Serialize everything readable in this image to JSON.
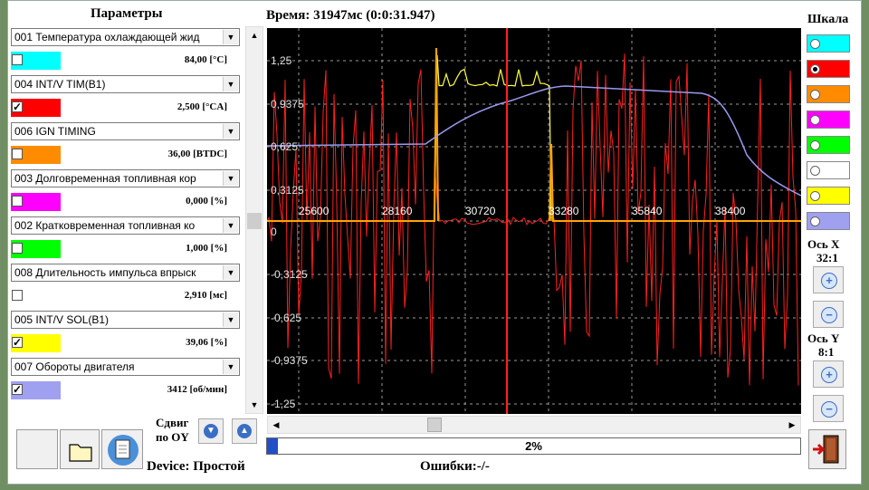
{
  "params_panel": {
    "title": "Параметры",
    "items": [
      {
        "combo": "001 Температура охлаждающей жид",
        "color": "#00ffff",
        "checked": false,
        "value": "84,00 [°C]"
      },
      {
        "combo": "004 INT/V TIM(B1)",
        "color": "#ff0000",
        "checked": true,
        "value": "2,500 [°CA]"
      },
      {
        "combo": "006 IGN TIMING",
        "color": "#ff8c00",
        "checked": false,
        "value": "36,00 [BTDC]"
      },
      {
        "combo": "003 Долговременная топливная кор",
        "color": "#ff00ff",
        "checked": false,
        "value": "0,000 [%]"
      },
      {
        "combo": "002 Кратковременная топливная ко",
        "color": "#00ff00",
        "checked": false,
        "value": "1,000 [%]"
      },
      {
        "combo": "008 Длительность импульса впрыск",
        "color": "#ffffff",
        "checked": false,
        "value": "2,910 [мс]"
      },
      {
        "combo": "005 INT/V SOL(B1)",
        "color": "#ffff00",
        "checked": true,
        "value": "39,06 [%]"
      },
      {
        "combo": "007 Обороты двигателя",
        "color": "#a0a0f0",
        "checked": true,
        "value": "3412 [об/мин]"
      }
    ]
  },
  "toolbar": {
    "shift_label_1": "Сдвиг",
    "shift_label_2": "по OY"
  },
  "status": {
    "device": "Device: Простой",
    "errors": "Ошибки:-/-"
  },
  "chart": {
    "time_label": "Время: 31947мс (0:0:31.947)",
    "progress_text": "2%",
    "progress_fraction": 0.02
  },
  "chart_data": {
    "type": "line",
    "x_ticks": [
      "25600",
      "28160",
      "30720",
      "33280",
      "35840",
      "38400"
    ],
    "y_ticks": [
      "1,25",
      "0,9375",
      "0,625",
      "0,3125",
      "0",
      "-0,3125",
      "-0,625",
      "-0,9375",
      "-1,25"
    ],
    "ylim": [
      -1.25,
      1.25
    ],
    "cursor_x": 31947,
    "series": [
      {
        "color": "#ff2020",
        "kind": "noise"
      },
      {
        "color": "#ffff40",
        "kind": "signal"
      },
      {
        "color": "#ffa500",
        "kind": "pulse"
      },
      {
        "color": "#9999ee",
        "kind": "rpm"
      }
    ],
    "background": "#000000",
    "grid": true
  },
  "scale_panel": {
    "title": "Шкала",
    "colors": [
      "#00ffff",
      "#ff0000",
      "#ff8c00",
      "#ff00ff",
      "#00ff00",
      "#ffffff",
      "#ffff00",
      "#a0a0f0"
    ],
    "selected_index": 1,
    "axis_x_label": "Ось X",
    "axis_x_value": "32:1",
    "axis_y_label": "Ось Y",
    "axis_y_value": "8:1"
  }
}
